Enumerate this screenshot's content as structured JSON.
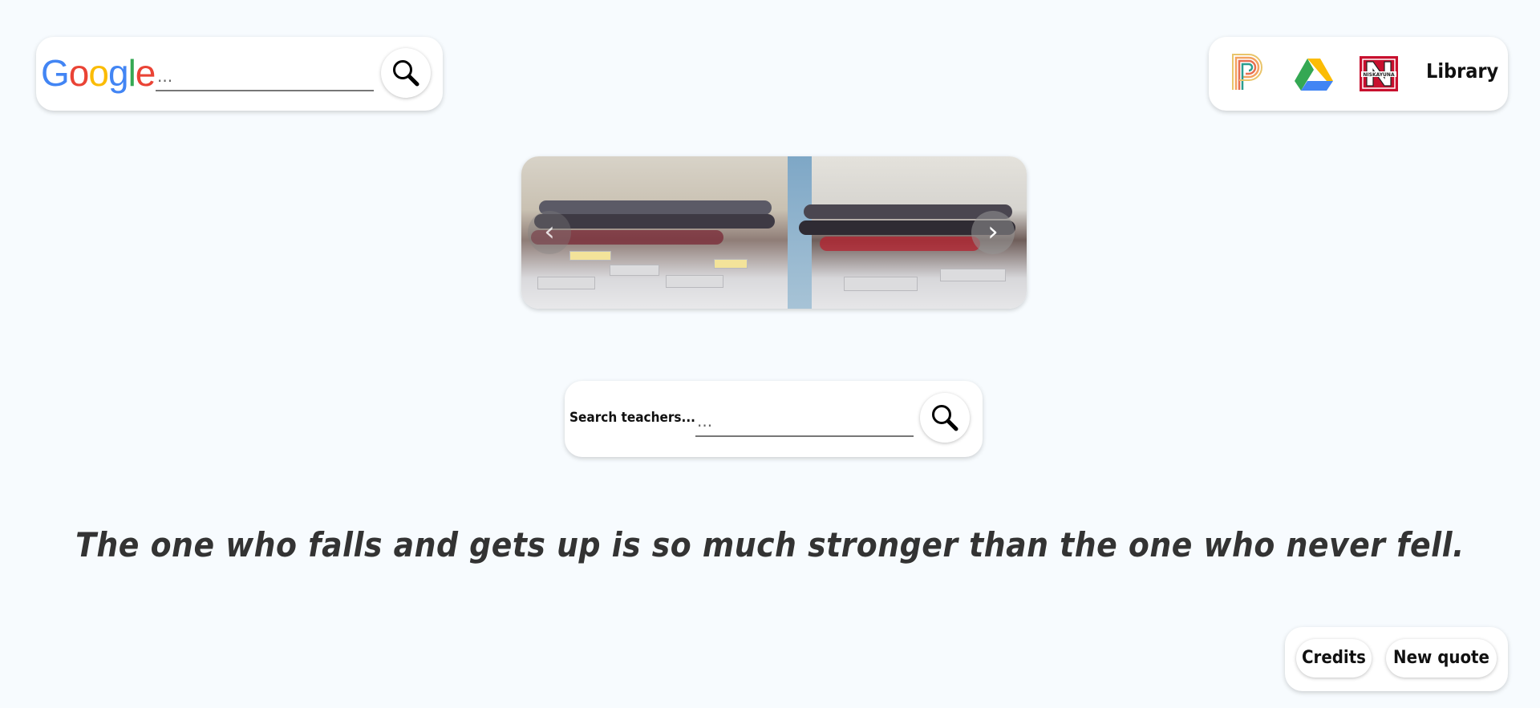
{
  "google_search": {
    "logo_text": "Google",
    "input_placeholder": "...",
    "button_icon": "search-icon"
  },
  "links": {
    "items": [
      {
        "name": "PowerSchool",
        "icon": "powerschool-icon"
      },
      {
        "name": "Google Drive",
        "icon": "google-drive-icon"
      },
      {
        "name": "Niskayuna",
        "icon": "niskayuna-logo-icon"
      }
    ],
    "library_label": "Library"
  },
  "carousel": {
    "prev_icon": "chevron-left-icon",
    "next_icon": "chevron-right-icon",
    "prev_glyph": "‹",
    "next_glyph": "›"
  },
  "teacher_search": {
    "label": "Search teachers...",
    "input_placeholder": "...",
    "button_icon": "search-icon"
  },
  "quote": {
    "text": "The one who falls and gets up is so much stronger than the one who never fell."
  },
  "footer": {
    "credits_label": "Credits",
    "new_quote_label": "New quote"
  },
  "colors": {
    "background": "#f7fbfe",
    "card": "#ffffff",
    "niskayuna_red": "#c8102e"
  }
}
